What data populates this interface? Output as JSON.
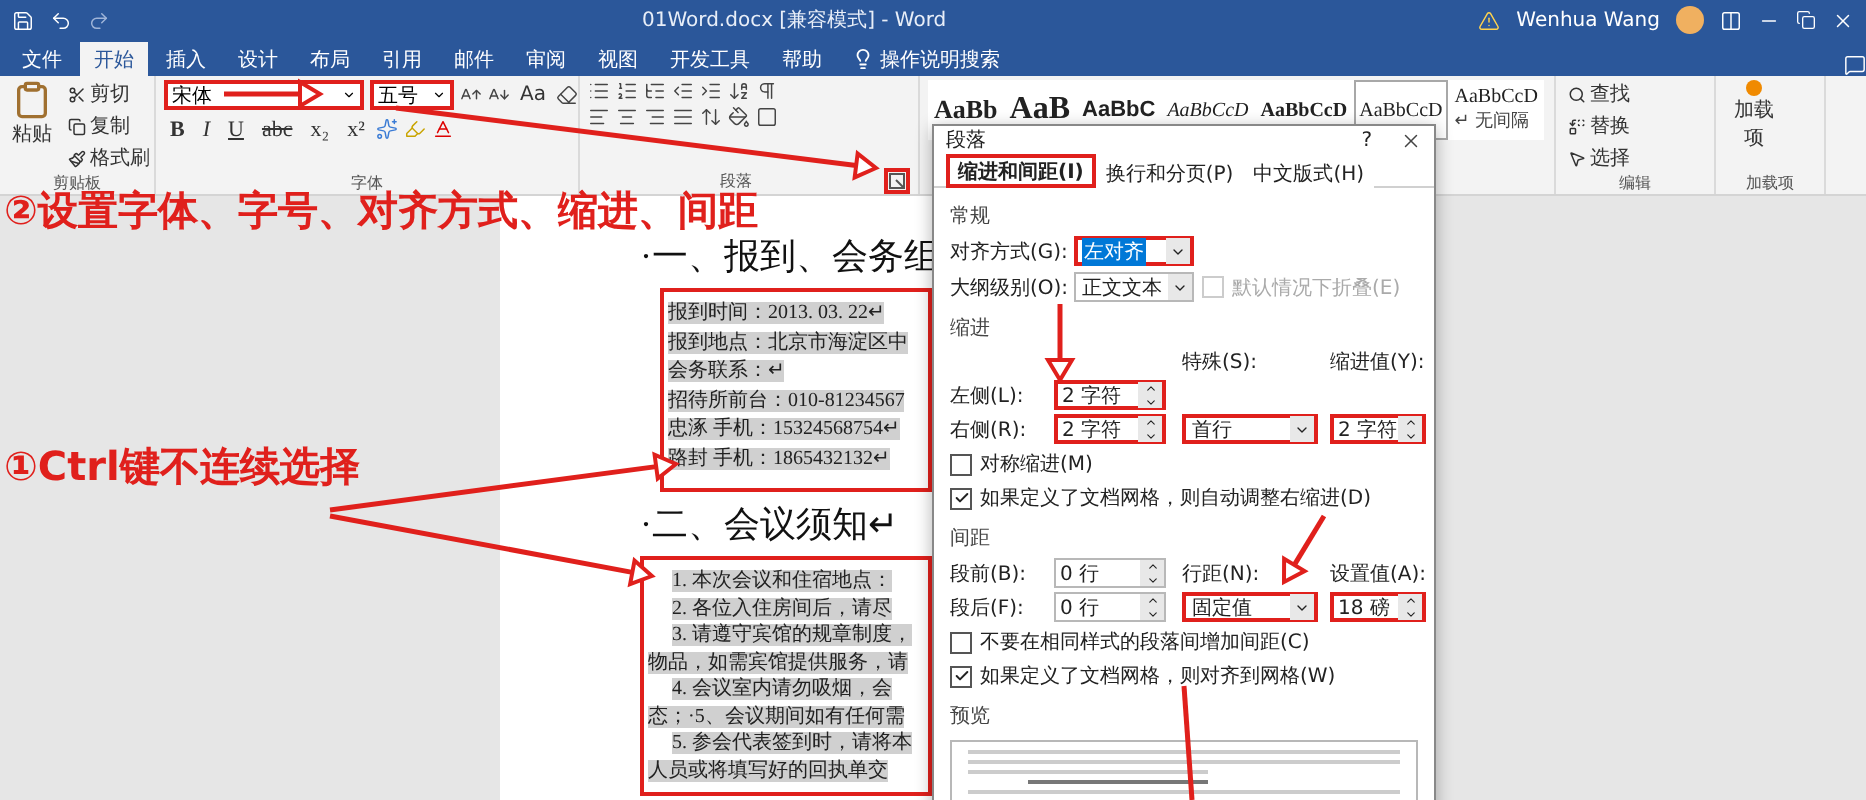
{
  "title_bar": {
    "title": "01Word.docx [兼容模式] - Word",
    "user": "Wenhua Wang"
  },
  "menu_tabs": [
    {
      "label": "文件",
      "selected": false
    },
    {
      "label": "开始",
      "selected": true
    },
    {
      "label": "插入",
      "selected": false
    },
    {
      "label": "设计",
      "selected": false
    },
    {
      "label": "布局",
      "selected": false
    },
    {
      "label": "引用",
      "selected": false
    },
    {
      "label": "邮件",
      "selected": false
    },
    {
      "label": "审阅",
      "selected": false
    },
    {
      "label": "视图",
      "selected": false
    },
    {
      "label": "开发工具",
      "selected": false
    },
    {
      "label": "帮助",
      "selected": false
    }
  ],
  "tell_me": "操作说明搜索",
  "ribbon": {
    "clipboard": {
      "paste": "粘贴",
      "items": [
        "剪切",
        "复制",
        "格式刷"
      ],
      "label": "剪贴板"
    },
    "font": {
      "font_name": {
        "value": "宋体",
        "marked": true
      },
      "font_size": {
        "value": "五号",
        "marked": true
      },
      "case_button": "Aa",
      "format_buttons": [
        "B",
        "I",
        "U",
        "abc",
        "x₂",
        "x²"
      ],
      "label": "字体"
    },
    "paragraph": {
      "label": "段落",
      "launcher": {
        "marked": true
      }
    },
    "styles": [
      {
        "sample": "AaBb",
        "kind": "heading",
        "selected": false
      },
      {
        "sample": "AaB",
        "kind": "title",
        "selected": false
      },
      {
        "sample": "AaBbC",
        "kind": "subtitle",
        "selected": false
      },
      {
        "sample": "AaBbCcD",
        "kind": "emphasis",
        "selected": false
      },
      {
        "sample": "AaBbCcD",
        "kind": "strong",
        "selected": false
      },
      {
        "sample": "AaBbCcD",
        "kind": "normal",
        "selected": true
      },
      {
        "sample": "AaBbCcD",
        "kind": "normal",
        "selected": false,
        "caption": "↵ 无间隔"
      }
    ],
    "editing": {
      "items": [
        "查找",
        "替换",
        "选择"
      ],
      "label": "编辑"
    },
    "addins": {
      "button": "加载项",
      "label": "加载项"
    }
  },
  "annotations": [
    {
      "text": "②设置字体、字号、对齐方式、缩进、间距"
    },
    {
      "text": "①Ctrl键不连续选择"
    }
  ],
  "document": [
    {
      "kind": "heading",
      "text": "·一、报到、会务组"
    },
    {
      "kind": "block",
      "marked": true,
      "lines": [
        {
          "kind": "plain",
          "text": "报到时间：2013. 03. 22↵"
        },
        {
          "kind": "plain",
          "text": "报到地点：北京市海淀区中"
        },
        {
          "kind": "plain",
          "text": "会务联系：↵"
        },
        {
          "kind": "plain",
          "text": "招待所前台：010-81234567"
        },
        {
          "kind": "plain",
          "text": "忠涿 手机：15324568754↵"
        },
        {
          "kind": "plain",
          "text": "路封 手机：1865432132↵"
        }
      ]
    },
    {
      "kind": "heading",
      "text": "·二、会议须知↵"
    },
    {
      "kind": "block",
      "marked": true,
      "lines": [
        {
          "kind": "first",
          "text": "1. 本次会议和住宿地点："
        },
        {
          "kind": "first",
          "text": "2. 各位入住房间后，请尽"
        },
        {
          "kind": "first",
          "text": "3. 请遵守宾馆的规章制度，"
        },
        {
          "kind": "plain",
          "text": "物品，如需宾馆提供服务，请"
        },
        {
          "kind": "first",
          "text": "4. 会议室内请勿吸烟，会"
        },
        {
          "kind": "plain",
          "text": "态；·5、会议期间如有任何需"
        },
        {
          "kind": "first",
          "text": "5. 参会代表签到时，请将本"
        },
        {
          "kind": "plain",
          "text": "人员或将填写好的回执单交"
        }
      ]
    }
  ],
  "dialog": {
    "title": "段落",
    "help": "?",
    "tabs": [
      {
        "label": "缩进和间距(I)",
        "selected": true,
        "marked": true
      },
      {
        "label": "换行和分页(P)",
        "selected": false,
        "marked": false
      },
      {
        "label": "中文版式(H)",
        "selected": false,
        "marked": false
      }
    ],
    "general": {
      "heading": "常规",
      "alignment": {
        "label": "对齐方式(G):",
        "value": "左对齐",
        "marked": true,
        "focused": true
      },
      "outline_level": {
        "label": "大纲级别(O):",
        "value": "正文文本",
        "marked": false,
        "focused": false
      },
      "collapsed": {
        "label": "默认情况下折叠(E)",
        "checked": false,
        "disabled": true
      }
    },
    "indent": {
      "heading": "缩进",
      "left": {
        "label": "左侧(L):",
        "value": "2 字符",
        "marked": true
      },
      "right": {
        "label": "右侧(R):",
        "value": "2 字符",
        "marked": true
      },
      "special": {
        "label": "特殊(S):",
        "value": "首行",
        "marked": true,
        "focused": false
      },
      "by": {
        "label": "缩进值(Y):",
        "value": "2 字符",
        "marked": true
      },
      "mirror": {
        "label": "对称缩进(M)",
        "checked": false,
        "disabled": false
      },
      "auto_adjust": {
        "label": "如果定义了文档网格，则自动调整右缩进(D)",
        "checked": true,
        "disabled": false
      }
    },
    "spacing": {
      "heading": "间距",
      "before": {
        "label": "段前(B):",
        "value": "0 行",
        "marked": false
      },
      "after": {
        "label": "段后(F):",
        "value": "0 行",
        "marked": false
      },
      "line_spacing": {
        "label": "行距(N):",
        "value": "固定值",
        "marked": true,
        "focused": false
      },
      "at": {
        "label": "设置值(A):",
        "value": "18 磅",
        "marked": true
      },
      "no_space": {
        "label": "不要在相同样式的段落间增加间距(C)",
        "checked": false,
        "disabled": false
      },
      "snap": {
        "label": "如果定义了文档网格，则对齐到网格(W)",
        "checked": true,
        "disabled": false
      }
    },
    "preview": {
      "heading": "预览"
    }
  }
}
